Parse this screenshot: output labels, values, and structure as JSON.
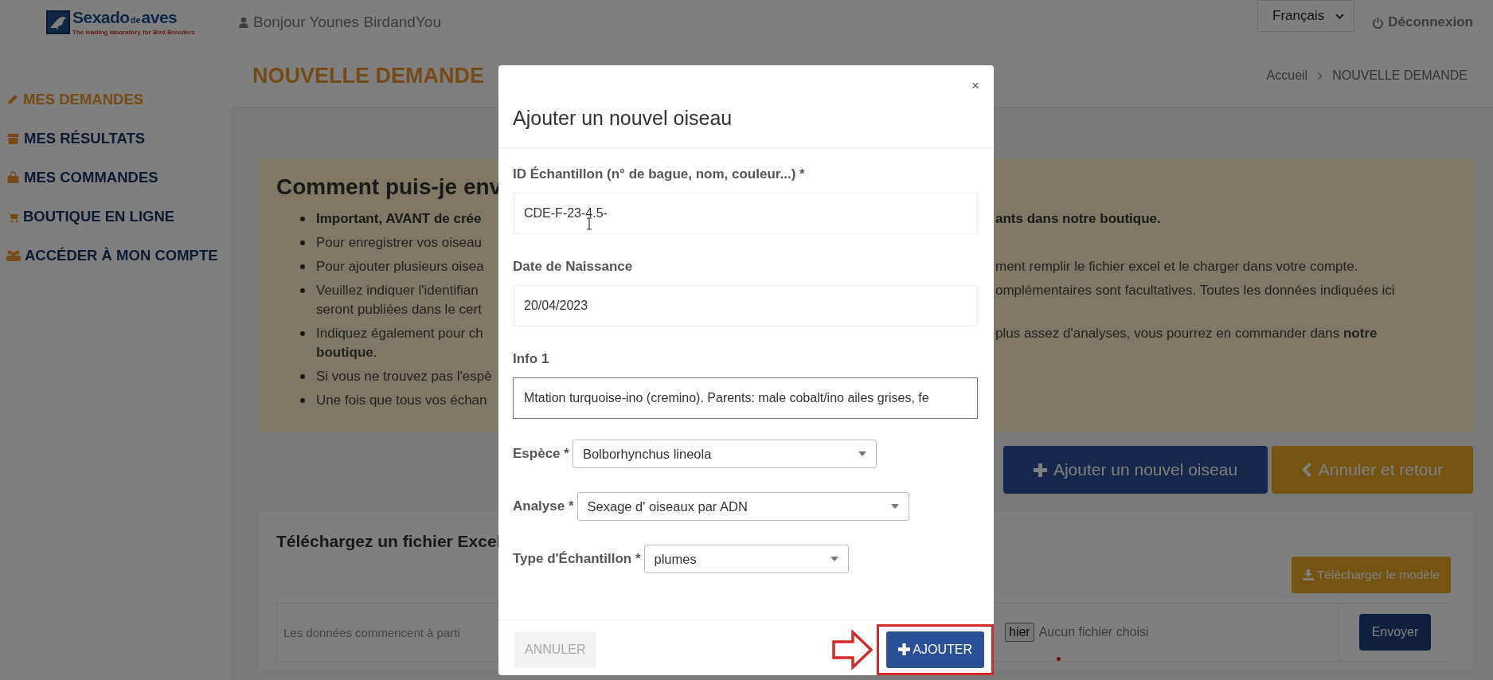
{
  "header": {
    "logo": {
      "name": "Sexado",
      "connector": "de",
      "name_end": "aves",
      "tagline": "The leading laboratory for Bird Breeders"
    },
    "greeting": "Bonjour Younes BirdandYou",
    "language": "Français",
    "logout": "Déconnexion"
  },
  "sidebar": {
    "items": [
      {
        "label": "MES DEMANDES",
        "selected": true
      },
      {
        "label": "MES RÉSULTATS",
        "selected": false
      },
      {
        "label": "MES COMMANDES",
        "selected": false
      },
      {
        "label": "BOUTIQUE EN LIGNE",
        "selected": false
      },
      {
        "label": "ACCÉDER À MON COMPTE",
        "selected": false
      }
    ]
  },
  "page": {
    "title": "NOUVELLE DEMANDE",
    "breadcrumb": [
      "Accueil",
      "NOUVELLE DEMANDE"
    ]
  },
  "info": {
    "heading": "Comment puis-je env",
    "bullets": [
      {
        "left": [
          "Important, AVANT de crée"
        ],
        "right": "ants dans notre boutique.",
        "bold": true
      },
      {
        "left": [
          "Pour enregistrer vos oiseau"
        ],
        "bold": false
      },
      {
        "left": [
          "Pour ajouter plusieurs oisea"
        ],
        "right": "ment remplir le fichier excel et le charger dans votre compte.",
        "bold": false
      },
      {
        "left": [
          "Veuillez indiquer l'identifian",
          "seront publiées dans le cert"
        ],
        "right": "omplémentaires sont facultatives. Toutes les données indiquées ici",
        "bold": false
      },
      {
        "left": [
          "Indiquez également pour ch",
          "**boutique**."
        ],
        "right": "plus assez d'analyses, vous pourrez en commander dans **notre**",
        "bold": false
      },
      {
        "left": [
          "Si vous ne trouvez pas l'espè"
        ],
        "bold": false
      },
      {
        "left": [
          "Une fois que tous vos échan"
        ],
        "bold": false
      }
    ]
  },
  "actions": [
    {
      "label": "Ajouter un nouvel oiseau",
      "kind": "add"
    },
    {
      "label": "Annuler et retour",
      "kind": "back"
    }
  ],
  "upload": {
    "heading": "Téléchargez un fichier Excel",
    "download_button": "Télécharger le modèle",
    "note": "Les données commencent à parti",
    "file_button": "hier",
    "file_status": "Aucun fichier choisi",
    "submit": "Envoyer"
  },
  "modal": {
    "title": "Ajouter un nouvel oiseau",
    "close": "×",
    "fields": [
      {
        "kind": "text",
        "label": "ID Échantillon (n° de bague, nom, couleur...) *",
        "value": "CDE-F-23-4.5-",
        "focused": false
      },
      {
        "kind": "text",
        "label": "Date de Naissance",
        "value": "20/04/2023",
        "focused": false
      },
      {
        "kind": "text",
        "label": "Info 1",
        "value": "Mtation turquoise-ino (cremino). Parents: male cobalt/ino ailes grises, fe",
        "focused": true
      },
      {
        "kind": "select",
        "label": "Espèce *",
        "value": "Bolborhynchus lineola"
      },
      {
        "kind": "select",
        "label": "Analyse *",
        "value": "Sexage d' oiseaux par ADN"
      },
      {
        "kind": "select",
        "label": "Type d'Échantillon *",
        "value": "plumes"
      }
    ],
    "cancel": {
      "label": "ANNULER",
      "disabled": true
    },
    "submit": {
      "label": "AJOUTER",
      "highlighted": true
    }
  }
}
